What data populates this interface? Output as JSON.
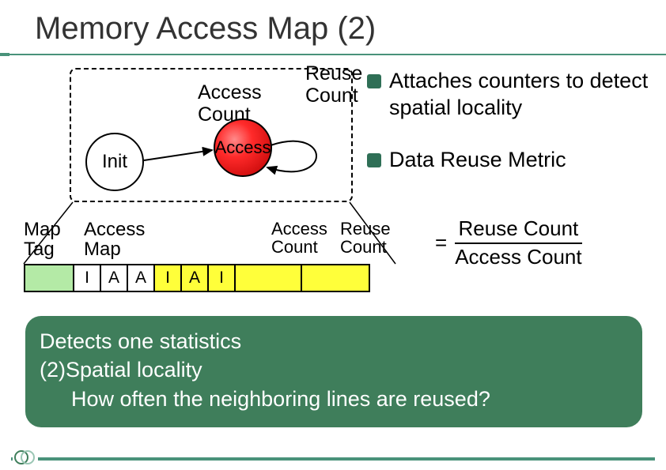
{
  "title": "Memory Access Map (2)",
  "diagram": {
    "init": "Init",
    "access": "Access",
    "access_count_label": "Access\nCount",
    "reuse_count_label": "Reuse\nCount"
  },
  "bullets": {
    "b1": "Attaches counters to detect spatial locality",
    "b2": "Data Reuse Metric"
  },
  "formula": {
    "eq": "=",
    "num": "Reuse Count",
    "den": "Access Count"
  },
  "table": {
    "maptag_label": "Map\nTag",
    "accessmap_label": "Access\nMap",
    "access_count_hdr": "Access\nCount",
    "reuse_count_hdr": "Reuse\nCount",
    "cells": [
      "I",
      "A",
      "A",
      "I",
      "A",
      "I"
    ]
  },
  "footer": {
    "l1": "Detects one statistics",
    "l2": "(2)Spatial locality",
    "l3": "How often the neighboring lines are reused?"
  }
}
